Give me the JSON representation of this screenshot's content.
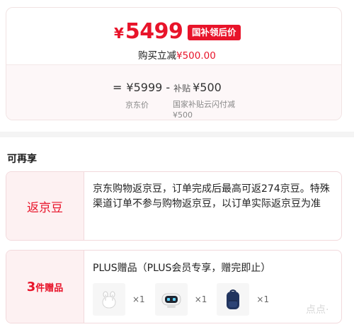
{
  "price": {
    "currency": "¥",
    "final": "5499",
    "badge": "国补领后价",
    "instant_label": "购买立减",
    "instant_amount": "¥500.00",
    "formula": {
      "equals": "=",
      "jd_price": "¥5999",
      "minus": "-",
      "subsidy_label": "补贴",
      "subsidy_amount": "¥500"
    },
    "caption_jd": "京东价",
    "caption_subsidy": "国家补贴云闪付减¥500"
  },
  "section_title": "可再享",
  "beans": {
    "label": "返京豆",
    "description": "京东购物返京豆，订单完成后最高可返274京豆。特殊渠道订单不参与购物返京豆，以订单实际返京豆为准"
  },
  "gifts": {
    "count": "3",
    "count_suffix": "件赠品",
    "title": "PLUS赠品（PLUS会员专享，赠完即止）",
    "items": [
      {
        "icon": "earbuds-icon",
        "quantity": "×1"
      },
      {
        "icon": "robot-speaker-icon",
        "quantity": "×1"
      },
      {
        "icon": "backpack-icon",
        "quantity": "×1"
      }
    ]
  },
  "watermark": "点点·",
  "colors": {
    "accent": "#e8142a",
    "label_bg": "#fdf1f2",
    "muted": "#888888"
  }
}
